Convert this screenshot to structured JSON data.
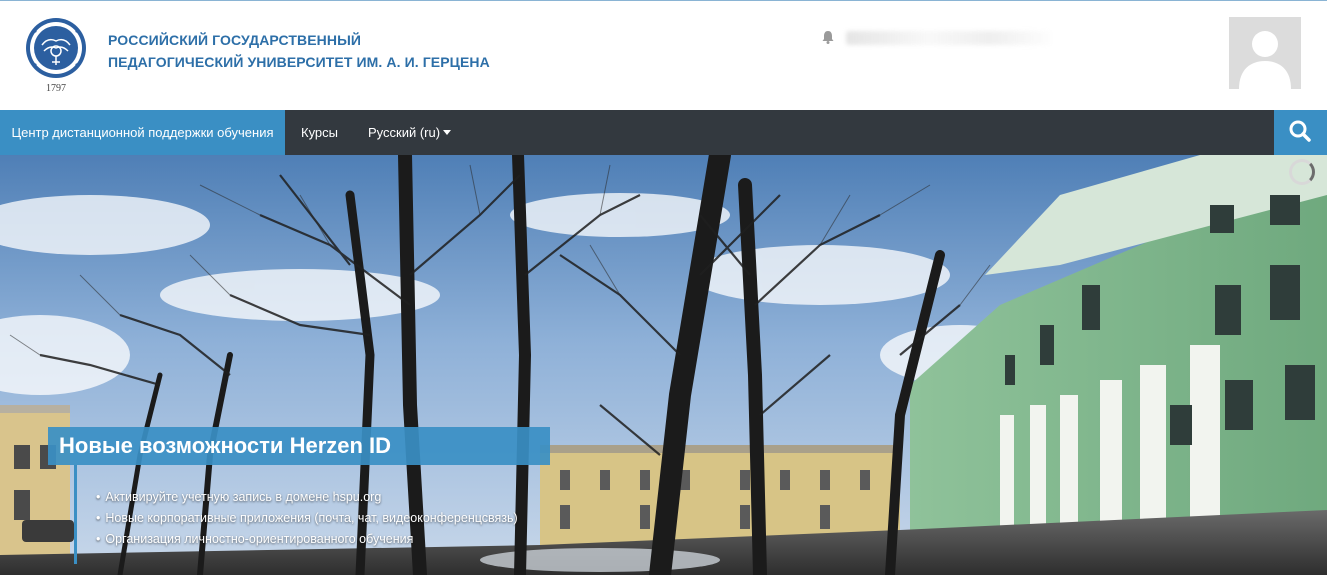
{
  "header": {
    "logo_year": "1797",
    "university_line1": "РОССИЙСКИЙ ГОСУДАРСТВЕННЫЙ",
    "university_line2": "ПЕДАГОГИЧЕСКИЙ УНИВЕРСИТЕТ ИМ. А. И. ГЕРЦЕНА"
  },
  "navbar": {
    "home_label": "Центр дистанционной поддержки обучения",
    "courses_label": "Курсы",
    "language_label": "Русский (ru)"
  },
  "slider": {
    "title": "Новые возможности Herzen ID",
    "items": [
      "Активируйте учетную запись в домене hspu.org",
      "Новые корпоративные приложения (почта, чат, видеоконференцсвязь)",
      "Организация личностно-ориентированного обучения"
    ]
  },
  "colors": {
    "accent": "#3a8fc4",
    "navbar": "#33393f",
    "title_text": "#2d6fa8"
  },
  "icons": [
    "university-logo",
    "bell-icon",
    "user-avatar",
    "caret-down-icon",
    "search-icon",
    "loading-spinner-icon"
  ]
}
